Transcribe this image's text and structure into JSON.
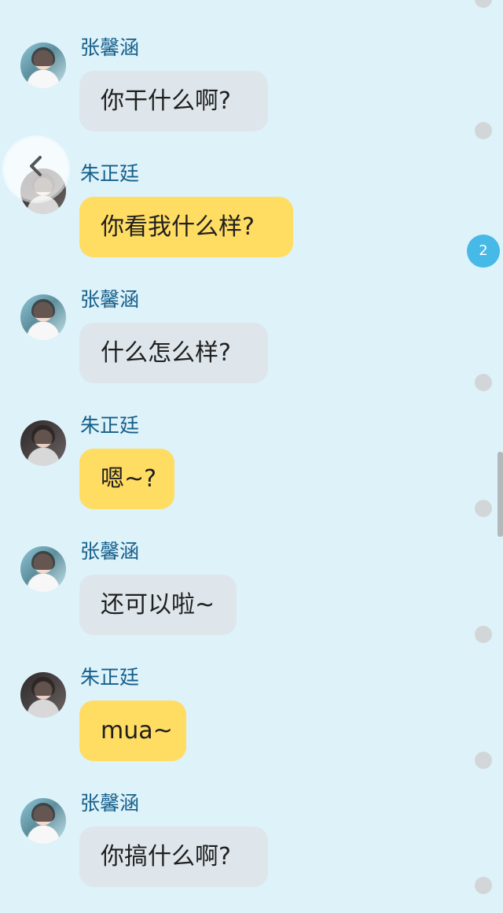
{
  "messages": [
    {
      "sender": "张馨涵",
      "text": "你干什么啊?",
      "side": "left"
    },
    {
      "sender": "朱正廷",
      "text": "你看我什么样?",
      "side": "left"
    },
    {
      "sender": "张馨涵",
      "text": "什么怎么样?",
      "side": "left"
    },
    {
      "sender": "朱正廷",
      "text": "嗯~?",
      "side": "left"
    },
    {
      "sender": "张馨涵",
      "text": "还可以啦~",
      "side": "left"
    },
    {
      "sender": "朱正廷",
      "text": "mua~",
      "side": "left"
    },
    {
      "sender": "张馨涵",
      "text": "你搞什么啊?",
      "side": "left"
    }
  ],
  "badge": "2",
  "icons": {
    "back": "back-arrow-icon"
  },
  "colors": {
    "background": "#def2fa",
    "name": "#145f8a",
    "grey_bubble": "#dee6eb",
    "yellow_bubble": "#ffdc62",
    "badge": "#46b9e6"
  }
}
